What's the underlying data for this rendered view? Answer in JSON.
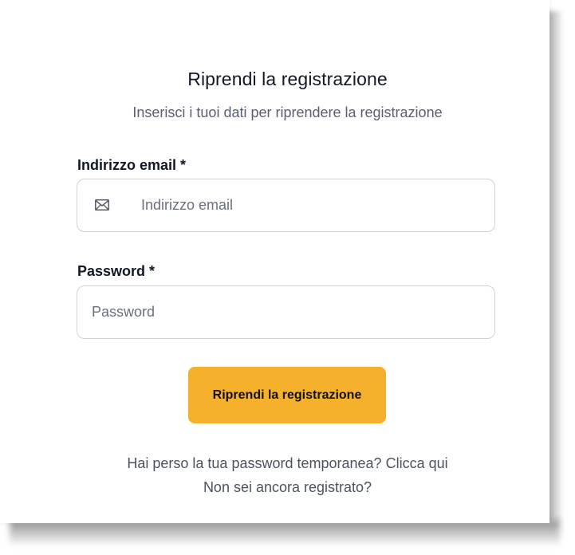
{
  "form": {
    "title": "Riprendi la registrazione",
    "subtitle": "Inserisci i tuoi dati per riprendere la registrazione",
    "email": {
      "label": "Indirizzo email *",
      "placeholder": "Indirizzo email",
      "value": "",
      "icon": "envelope-icon"
    },
    "password": {
      "label": "Password *",
      "placeholder": "Password",
      "value": ""
    },
    "submit_label": "Riprendi la registrazione"
  },
  "footer": {
    "lost_password_text": "Hai perso la tua password temporanea?",
    "lost_password_link": "Clicca qui",
    "not_registered": "Non sei ancora registrato?"
  },
  "colors": {
    "accent": "#f6b12c",
    "text_dark": "#121828",
    "text_muted": "#5a6070",
    "border": "#cfd3da"
  }
}
